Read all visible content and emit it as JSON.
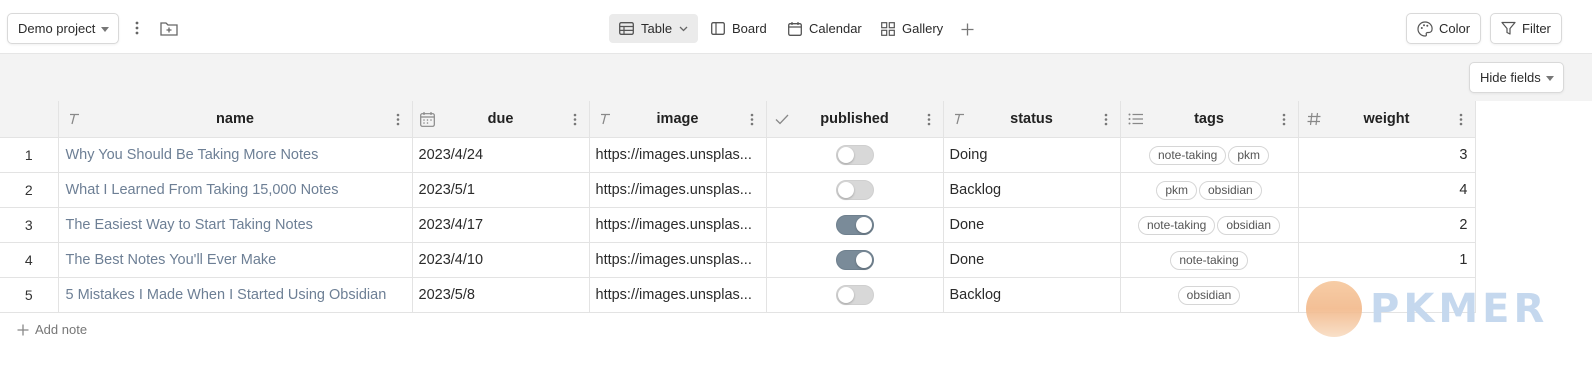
{
  "toolbar": {
    "project": "Demo project",
    "views": [
      {
        "label": "Table",
        "icon": "table-icon",
        "active": true
      },
      {
        "label": "Board",
        "icon": "board-icon"
      },
      {
        "label": "Calendar",
        "icon": "calendar-icon"
      },
      {
        "label": "Gallery",
        "icon": "gallery-icon"
      }
    ],
    "color_label": "Color",
    "filter_label": "Filter"
  },
  "subbar": {
    "hide_fields_label": "Hide fields"
  },
  "table": {
    "columns": [
      {
        "label": "name",
        "icon": "text-type-icon"
      },
      {
        "label": "due",
        "icon": "calendar-type-icon"
      },
      {
        "label": "image",
        "icon": "text-type-icon"
      },
      {
        "label": "published",
        "icon": "check-type-icon"
      },
      {
        "label": "status",
        "icon": "text-type-icon"
      },
      {
        "label": "tags",
        "icon": "list-type-icon"
      },
      {
        "label": "weight",
        "icon": "number-type-icon"
      }
    ],
    "rows": [
      {
        "num": "1",
        "name": "Why You Should Be Taking More Notes",
        "due": "2023/4/24",
        "image": "https://images.unsplas...",
        "published": false,
        "status": "Doing",
        "tags": [
          "note-taking",
          "pkm"
        ],
        "weight": "3"
      },
      {
        "num": "2",
        "name": "What I Learned From Taking 15,000 Notes",
        "due": "2023/5/1",
        "image": "https://images.unsplas...",
        "published": false,
        "status": "Backlog",
        "tags": [
          "pkm",
          "obsidian"
        ],
        "weight": "4"
      },
      {
        "num": "3",
        "name": "The Easiest Way to Start Taking Notes",
        "due": "2023/4/17",
        "image": "https://images.unsplas...",
        "published": true,
        "status": "Done",
        "tags": [
          "note-taking",
          "obsidian"
        ],
        "weight": "2"
      },
      {
        "num": "4",
        "name": "The Best Notes You'll Ever Make",
        "due": "2023/4/10",
        "image": "https://images.unsplas...",
        "published": true,
        "status": "Done",
        "tags": [
          "note-taking"
        ],
        "weight": "1"
      },
      {
        "num": "5",
        "name": "5 Mistakes I Made When I Started Using Obsidian",
        "due": "2023/5/8",
        "image": "https://images.unsplas...",
        "published": false,
        "status": "Backlog",
        "tags": [
          "obsidian"
        ],
        "weight": ""
      }
    ]
  },
  "add_note_label": "Add note",
  "watermark": {
    "text": "PKMER"
  },
  "colors": {
    "accent_toggle": "#7a8b99",
    "link_text": "#6d7f95"
  }
}
